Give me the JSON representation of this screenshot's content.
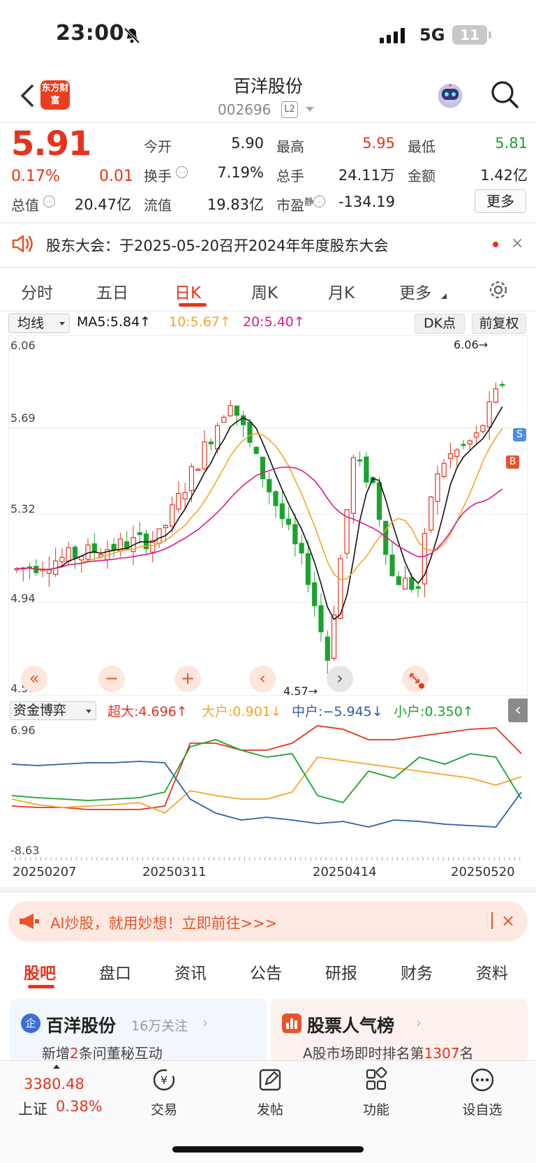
{
  "status_bar": {
    "time": "23:00",
    "network": "5G",
    "battery": "11"
  },
  "header": {
    "logo_text": "东方财富",
    "stock_name": "百洋股份",
    "stock_code": "002696",
    "level_badge": "L2"
  },
  "quote": {
    "price": "5.91",
    "change_pct": "0.17%",
    "change": "0.01",
    "open_label": "今开",
    "open": "5.90",
    "high_label": "最高",
    "high": "5.95",
    "low_label": "最低",
    "low": "5.81",
    "turnover_label": "换手",
    "turnover": "7.19%",
    "volume_label": "总手",
    "volume": "24.11万",
    "amount_label": "金额",
    "amount": "1.42亿",
    "mktcap_label": "总值",
    "mktcap": "20.47亿",
    "float_label": "流值",
    "float_cap": "19.83亿",
    "pe_label": "市盈",
    "pe_sup": "静",
    "pe": "-134.19",
    "more_label": "更多",
    "info_glyph": "…"
  },
  "notice": {
    "text": "股东大会：于2025-05-20召开2024年年度股东大会",
    "close": "×"
  },
  "chart_tabs": [
    {
      "label": "分时"
    },
    {
      "label": "五日"
    },
    {
      "label": "日K"
    },
    {
      "label": "周K"
    },
    {
      "label": "月K"
    },
    {
      "label": "更多"
    }
  ],
  "legend": {
    "ma_select": "均线",
    "ma5": "MA5:5.84↑",
    "ma10": "10:5.67↑",
    "ma20": "20:5.40↑",
    "dk_label": "DK点",
    "adjust_label": "前复权"
  },
  "price_axis": {
    "top": "6.06",
    "l2": "5.69",
    "l3": "5.32",
    "l4": "4.94",
    "bottom": "4.57"
  },
  "price_markers": {
    "high": "6.06→",
    "low": "4.57→",
    "sell": "S",
    "buy": "B"
  },
  "chart_controls": {
    "left_fast": "«",
    "zoom_out": "−",
    "zoom_in": "+",
    "prev": "‹",
    "next": "›"
  },
  "fund_flow": {
    "select": "资金博弈",
    "super": "超大:4.696↑",
    "large": "大户:0.901↓",
    "medium": "中户:−5.945↓",
    "small": "小户:0.350↑",
    "axis_top": "6.96",
    "axis_bottom": "-8.63",
    "expand": "‹"
  },
  "dates": {
    "d1": "20250207",
    "d2": "20250311",
    "d3": "20250414",
    "d4": "20250520"
  },
  "colors": {
    "up": "#e8321e",
    "down": "#1aa32f",
    "ma5": "#111111",
    "ma10": "#f5a623",
    "ma20": "#d81b8a",
    "medium": "#2d5ea8"
  },
  "ai_banner": {
    "text": "AI炒股，就用妙想！立即前往>>>",
    "close": "×"
  },
  "bottom_tabs": [
    {
      "label": "股吧"
    },
    {
      "label": "盘口"
    },
    {
      "label": "资讯"
    },
    {
      "label": "公告"
    },
    {
      "label": "研报"
    },
    {
      "label": "财务"
    },
    {
      "label": "资料"
    }
  ],
  "card_left": {
    "badge": "企",
    "title": "百洋股份",
    "followers": "16万关注",
    "sub_prefix": "新增",
    "sub_num": "2",
    "sub_suffix": "条问董秘互动"
  },
  "card_right": {
    "title": "股票人气榜",
    "sub_prefix": "A股市场即时排名第",
    "sub_num": "1307",
    "sub_suffix": "名"
  },
  "bottom_nav": {
    "index_value": "3380.48",
    "index_name": "上证",
    "index_pct": "0.38%",
    "trade": "交易",
    "post": "发帖",
    "func": "功能",
    "watch": "设自选"
  }
}
